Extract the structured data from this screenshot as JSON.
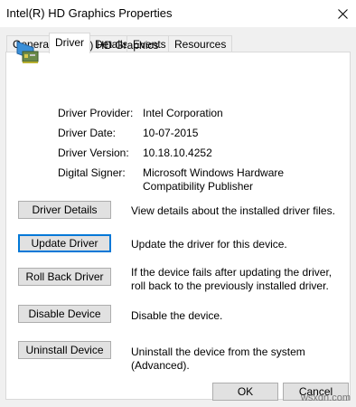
{
  "window": {
    "title": "Intel(R) HD Graphics Properties"
  },
  "tabs": [
    {
      "label": "General"
    },
    {
      "label": "Driver",
      "active": true
    },
    {
      "label": "Details"
    },
    {
      "label": "Events"
    },
    {
      "label": "Resources"
    }
  ],
  "device": {
    "name": "Intel(R) HD Graphics",
    "icon": "display-adapter-icon"
  },
  "properties": {
    "provider_label": "Driver Provider:",
    "provider_value": "Intel Corporation",
    "date_label": "Driver Date:",
    "date_value": "10-07-2015",
    "version_label": "Driver Version:",
    "version_value": "10.18.10.4252",
    "signer_label": "Digital Signer:",
    "signer_value": "Microsoft Windows Hardware Compatibility Publisher"
  },
  "actions": {
    "details_label": "Driver Details",
    "details_desc": "View details about the installed driver files.",
    "update_label": "Update Driver",
    "update_desc": "Update the driver for this device.",
    "rollback_label": "Roll Back Driver",
    "rollback_desc": "If the device fails after updating the driver, roll back to the previously installed driver.",
    "disable_label": "Disable Device",
    "disable_desc": "Disable the device.",
    "uninstall_label": "Uninstall Device",
    "uninstall_desc": "Uninstall the device from the system (Advanced)."
  },
  "footer": {
    "ok_label": "OK",
    "cancel_label": "Cancel"
  },
  "watermark": "wsxdn.com",
  "colors": {
    "focus": "#0078d7",
    "button_bg": "#e1e1e1",
    "dialog_bg": "#f0f0f0"
  }
}
